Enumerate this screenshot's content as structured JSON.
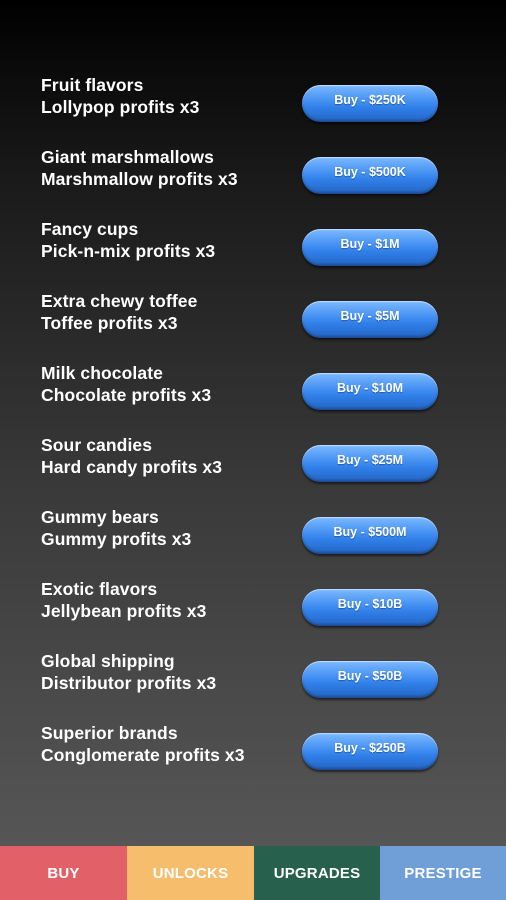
{
  "upgrades": [
    {
      "name": "Fruit flavors",
      "effect": "Lollypop profits x3",
      "button": "Buy - $250K"
    },
    {
      "name": "Giant marshmallows",
      "effect": "Marshmallow profits x3",
      "button": "Buy - $500K"
    },
    {
      "name": "Fancy cups",
      "effect": "Pick-n-mix profits x3",
      "button": "Buy - $1M"
    },
    {
      "name": "Extra chewy toffee",
      "effect": "Toffee profits x3",
      "button": "Buy - $5M"
    },
    {
      "name": "Milk chocolate",
      "effect": "Chocolate profits x3",
      "button": "Buy - $10M"
    },
    {
      "name": "Sour candies",
      "effect": "Hard candy profits x3",
      "button": "Buy - $25M"
    },
    {
      "name": "Gummy bears",
      "effect": "Gummy profits x3",
      "button": "Buy - $500M"
    },
    {
      "name": "Exotic flavors",
      "effect": "Jellybean profits x3",
      "button": "Buy - $10B"
    },
    {
      "name": "Global shipping",
      "effect": "Distributor profits x3",
      "button": "Buy - $50B"
    },
    {
      "name": "Superior brands",
      "effect": "Conglomerate profits x3",
      "button": "Buy - $250B"
    }
  ],
  "tabs": {
    "buy": "BUY",
    "unlocks": "UNLOCKS",
    "upgrades": "UPGRADES",
    "prestige": "PRESTIGE"
  },
  "colors": {
    "buy_tab": "#e26068",
    "unlocks_tab": "#f5bd6c",
    "upgrades_tab": "#27614e",
    "prestige_tab": "#6f9fd6",
    "button_blue": "#2f7fe8"
  }
}
